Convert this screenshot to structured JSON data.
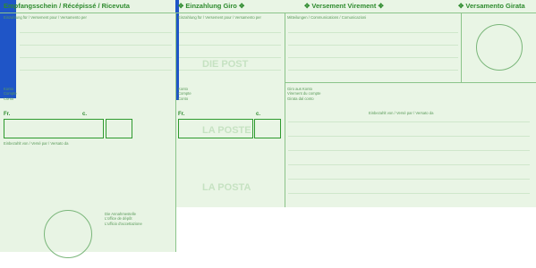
{
  "headers": {
    "receipt": "Empfangsschein / Récépissé / Ricevuta",
    "giro_de": "Einzahlung Giro",
    "giro_fr": "Versement Virement",
    "giro_it": "Versamento Girata"
  },
  "labels": {
    "pay_for_left": "Einzahlung für / Versement pour / Versamento per",
    "pay_for_middle": "Einzahlung für / Versement pour / Versamento per",
    "communications": "Mitteilungen / Communications / Comunicazioni",
    "account_left": [
      "Konto",
      "Compte",
      "Conto"
    ],
    "account_middle": [
      "Konto",
      "Compte",
      "Conto"
    ],
    "giro_account": [
      "Giro aus Konto",
      "Virement du compte",
      "Girata dal conto"
    ],
    "paid_by_right": "Einbezahlt von / Versé par / Versato da",
    "paid_by_left": "Einbezahlt von / Versé par / Versato da",
    "office": [
      "Die Annahmestelle",
      "L'office de dépôt",
      "L'ufficio d'accettazione"
    ],
    "fr": "Fr.",
    "c": "c."
  },
  "watermarks": [
    "DIE POST",
    "LA POSTE",
    "LA POSTA"
  ]
}
